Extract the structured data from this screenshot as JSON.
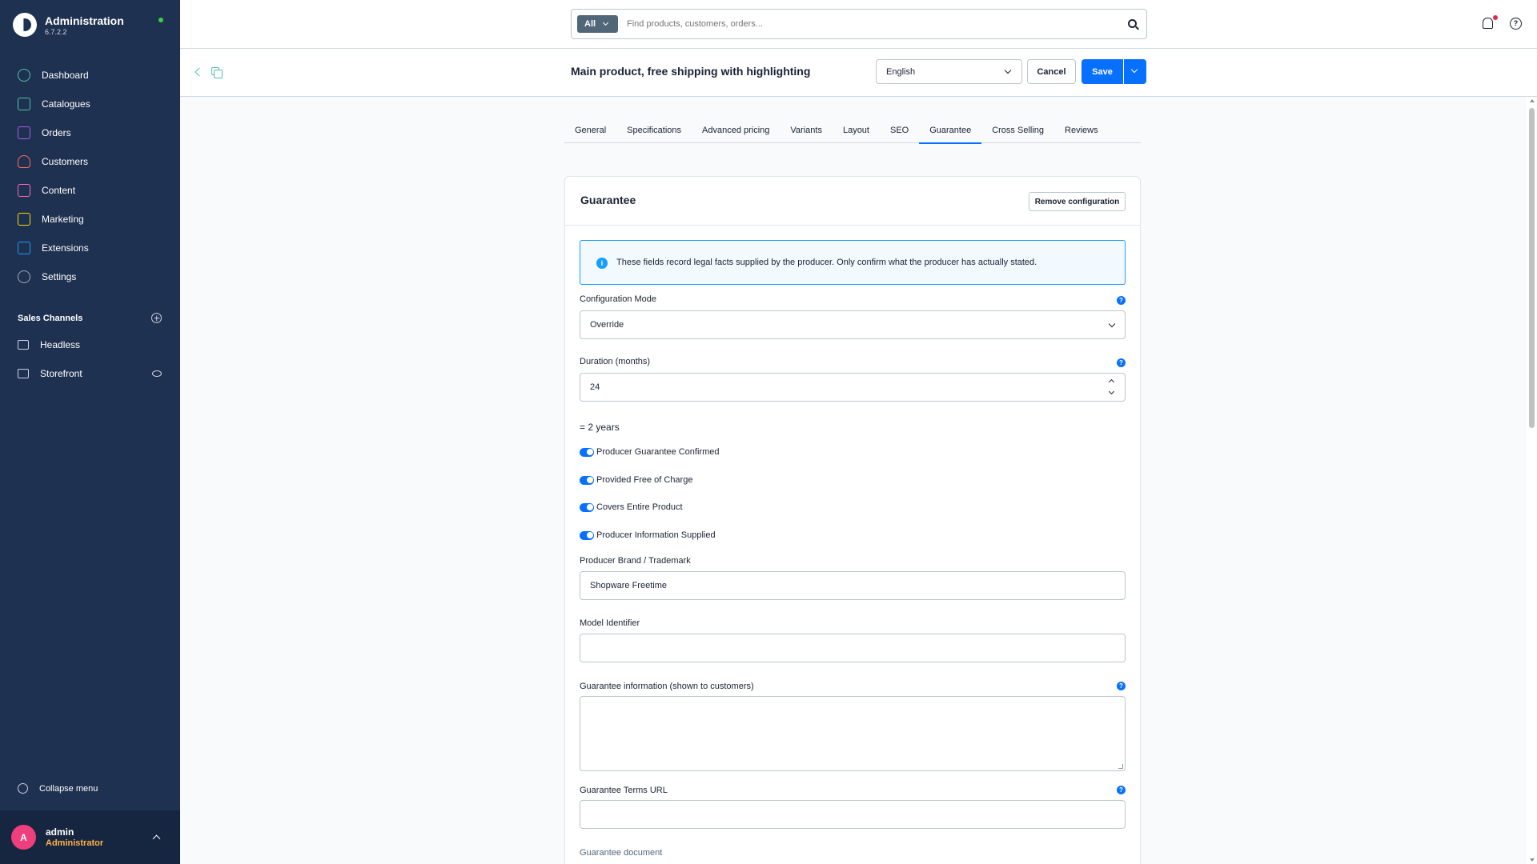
{
  "app": {
    "title": "Administration",
    "version": "6.7.2.2"
  },
  "sidebar": {
    "items": [
      {
        "label": "Dashboard",
        "icon": "dashboard-icon",
        "color": "#52c0a6"
      },
      {
        "label": "Catalogues",
        "icon": "catalogues-icon",
        "color": "#52c0a6"
      },
      {
        "label": "Orders",
        "icon": "orders-icon",
        "color": "#a560e8"
      },
      {
        "label": "Customers",
        "icon": "customers-icon",
        "color": "#ff6b5b"
      },
      {
        "label": "Content",
        "icon": "content-icon",
        "color": "#ff68b4"
      },
      {
        "label": "Marketing",
        "icon": "marketing-icon",
        "color": "#ffd700"
      },
      {
        "label": "Extensions",
        "icon": "extensions-icon",
        "color": "#189eff"
      },
      {
        "label": "Settings",
        "icon": "settings-icon",
        "color": "#9aa8b5"
      }
    ],
    "sales_channels_title": "Sales Channels",
    "sales_channels": [
      {
        "label": "Headless",
        "icon": "headless-icon"
      },
      {
        "label": "Storefront",
        "icon": "storefront-icon"
      }
    ],
    "collapse_label": "Collapse menu",
    "user": {
      "initial": "A",
      "name": "admin",
      "role": "Administrator"
    }
  },
  "topbar": {
    "search_type": "All",
    "search_placeholder": "Find products, customers, orders..."
  },
  "smartbar": {
    "title": "Main product, free shipping with highlighting",
    "language": "English",
    "cancel_label": "Cancel",
    "save_label": "Save"
  },
  "tabs": [
    {
      "label": "General",
      "active": false
    },
    {
      "label": "Specifications",
      "active": false
    },
    {
      "label": "Advanced pricing",
      "active": false
    },
    {
      "label": "Variants",
      "active": false
    },
    {
      "label": "Layout",
      "active": false
    },
    {
      "label": "SEO",
      "active": false
    },
    {
      "label": "Guarantee",
      "active": true
    },
    {
      "label": "Cross Selling",
      "active": false
    },
    {
      "label": "Reviews",
      "active": false
    }
  ],
  "card": {
    "title": "Guarantee",
    "remove_label": "Remove configuration",
    "alert_text": "These fields record legal facts supplied by the producer. Only confirm what the producer has actually stated.",
    "config_mode_label": "Configuration Mode",
    "config_mode_value": "Override",
    "duration_label": "Duration (months)",
    "duration_value": "24",
    "duration_helper": "= 2 years",
    "toggles": [
      {
        "label": "Producer Guarantee Confirmed",
        "on": true
      },
      {
        "label": "Provided Free of Charge",
        "on": true
      },
      {
        "label": "Covers Entire Product",
        "on": true
      },
      {
        "label": "Producer Information Supplied",
        "on": true
      }
    ],
    "brand_label": "Producer Brand / Trademark",
    "brand_value": "Shopware Freetime",
    "model_label": "Model Identifier",
    "model_value": "",
    "info_label": "Guarantee information (shown to customers)",
    "terms_label": "Guarantee Terms URL",
    "document_label": "Guarantee document"
  }
}
